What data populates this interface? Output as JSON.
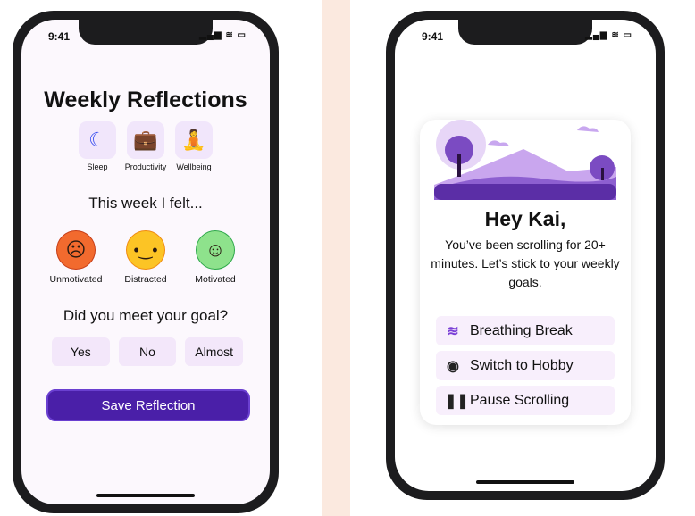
{
  "status": {
    "time": "9:41",
    "icons": "▂▄▆ ≋ ▭"
  },
  "reflections": {
    "title": "Weekly Reflections",
    "categories": [
      {
        "label": "Sleep",
        "icon": "moon-icon"
      },
      {
        "label": "Productivity",
        "icon": "briefcase-icon"
      },
      {
        "label": "Wellbeing",
        "icon": "meditation-icon"
      }
    ],
    "feeling_prompt": "This week I felt...",
    "moods": [
      {
        "label": "Unmotivated",
        "color": "#f26a2e",
        "glyph": "☹"
      },
      {
        "label": "Distracted",
        "color": "#fcc425",
        "glyph": "😐"
      },
      {
        "label": "Motivated",
        "color": "#8ee28c",
        "glyph": "☺"
      }
    ],
    "goal_prompt": "Did you meet your goal?",
    "answers": [
      "Yes",
      "No",
      "Almost"
    ],
    "save_label": "Save Reflection"
  },
  "nudge": {
    "greeting": "Hey Kai,",
    "message": "You’ve been scrolling for 20+ minutes. Let’s stick to your weekly goals.",
    "actions": [
      {
        "label": "Breathing Break",
        "icon": "wind-icon"
      },
      {
        "label": "Switch to Hobby",
        "icon": "record-icon"
      },
      {
        "label": "Pause Scrolling",
        "icon": "pause-icon"
      }
    ]
  },
  "colors": {
    "accent": "#4a1fa8",
    "icon_blue": "#3a4ff0",
    "button_bg": "#f3e7fa"
  }
}
